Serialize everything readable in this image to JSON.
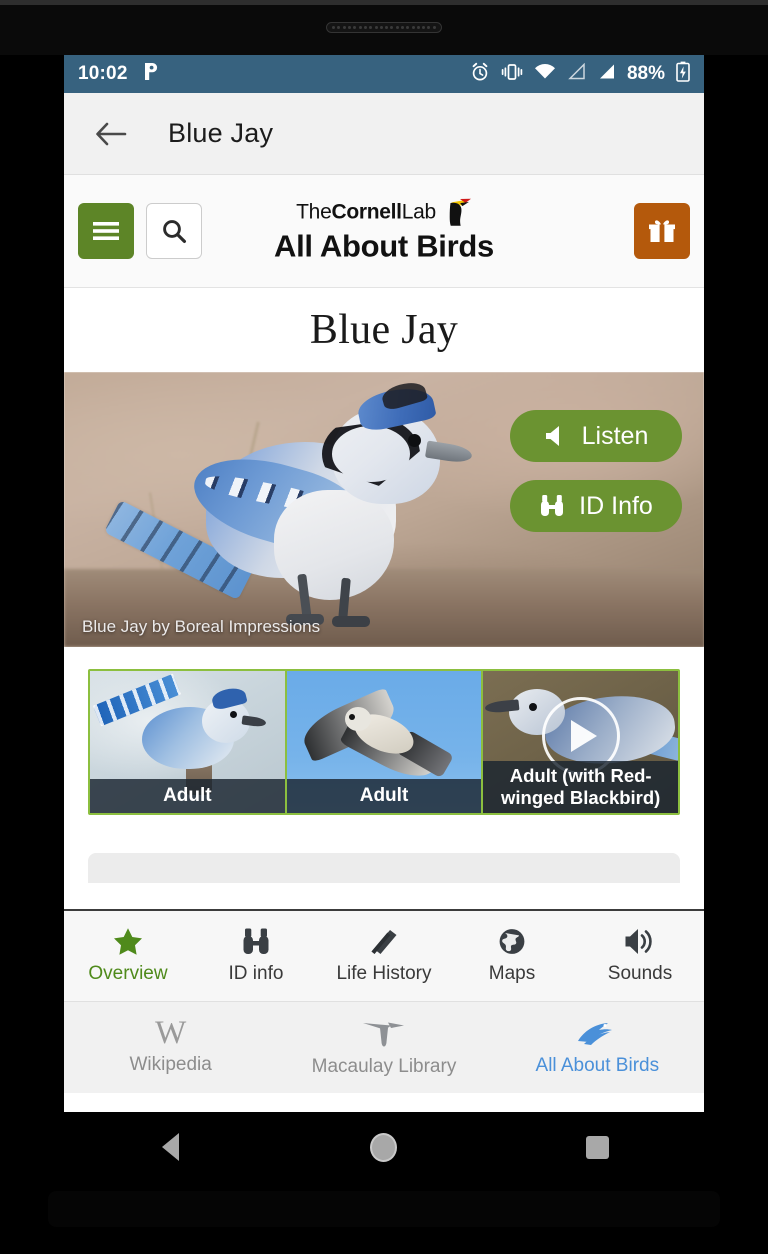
{
  "status_bar": {
    "time": "10:02",
    "battery_percent": "88%",
    "icons": [
      "pandora-icon",
      "alarm-icon",
      "vibrate-icon",
      "wifi-icon",
      "signal-empty-icon",
      "signal-full-icon",
      "battery-charging-icon"
    ]
  },
  "app_bar": {
    "back_label": "←",
    "title": "Blue Jay"
  },
  "site_header": {
    "menu_label": "Menu",
    "search_label": "Search",
    "gift_label": "Donate",
    "brand_the": "The",
    "brand_cornell": "Cornell",
    "brand_lab": "Lab",
    "brand_title": "All About Birds"
  },
  "species": {
    "name": "Blue Jay"
  },
  "hero": {
    "caption": "Blue Jay by Boreal Impressions",
    "listen_label": "Listen",
    "id_info_label": "ID Info"
  },
  "thumbnails": [
    {
      "label": "Adult",
      "has_video": false
    },
    {
      "label": "Adult",
      "has_video": false
    },
    {
      "label": "Adult (with Red-winged Blackbird)",
      "has_video": true
    }
  ],
  "tabs": [
    {
      "label": "Overview",
      "icon": "star-icon",
      "active": true
    },
    {
      "label": "ID info",
      "icon": "binoculars-icon",
      "active": false
    },
    {
      "label": "Life History",
      "icon": "book-icon",
      "active": false
    },
    {
      "label": "Maps",
      "icon": "globe-icon",
      "active": false
    },
    {
      "label": "Sounds",
      "icon": "speaker-icon",
      "active": false
    }
  ],
  "sources": [
    {
      "label": "Wikipedia",
      "icon": "wikipedia-icon",
      "glyph": "W",
      "active": false
    },
    {
      "label": "Macaulay Library",
      "icon": "hummingbird-icon",
      "active": false
    },
    {
      "label": "All About Birds",
      "icon": "allaboutbirds-bird-icon",
      "active": true
    }
  ],
  "android_nav": {
    "back_label": "Back",
    "home_label": "Home",
    "recents_label": "Recents"
  },
  "colors": {
    "status_bar": "#37627f",
    "accent_green": "#5d8527",
    "button_green": "#6b9331",
    "gift_orange": "#b4590c",
    "active_tab_green": "#4f8a1b",
    "active_source_blue": "#4a90d9",
    "thumb_border": "#8cbf3f"
  }
}
